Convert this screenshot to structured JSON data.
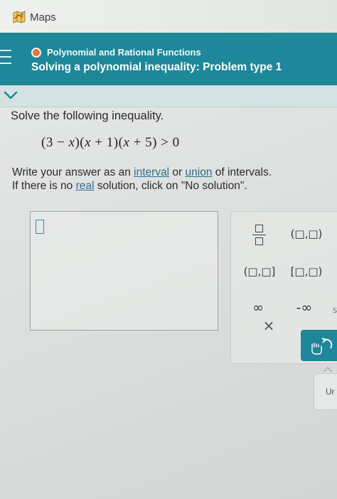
{
  "topbar": {
    "app_label": "Maps"
  },
  "header": {
    "topic": "Polynomial and Rational Functions",
    "title": "Solving a polynomial inequality: Problem type 1",
    "topic_dot_color": "#e2763a",
    "accent_color": "#1e8799"
  },
  "question": {
    "instruction": "Solve the following inequality.",
    "answer_line1_prefix": "Write your answer as an ",
    "link_interval": "interval",
    "answer_line1_mid": " or ",
    "link_union": "union",
    "answer_line1_suffix": " of intervals.",
    "answer_line2_prefix": "If there is no ",
    "link_real": "real",
    "answer_line2_suffix": " solution, click on \"No solution\"."
  },
  "keypad": {
    "open_interval": "(□,□)",
    "closed_open_interval": "(□,□]",
    "closed_interval": "[□,□)",
    "infinity": "∞",
    "neg_infinity": "-∞",
    "partial_label": "S",
    "clear": "×",
    "undo_partial": "Ur"
  },
  "icons": [
    "maps-icon",
    "menu-icon",
    "chevron-down-icon",
    "fraction-icon",
    "undo-icon"
  ]
}
